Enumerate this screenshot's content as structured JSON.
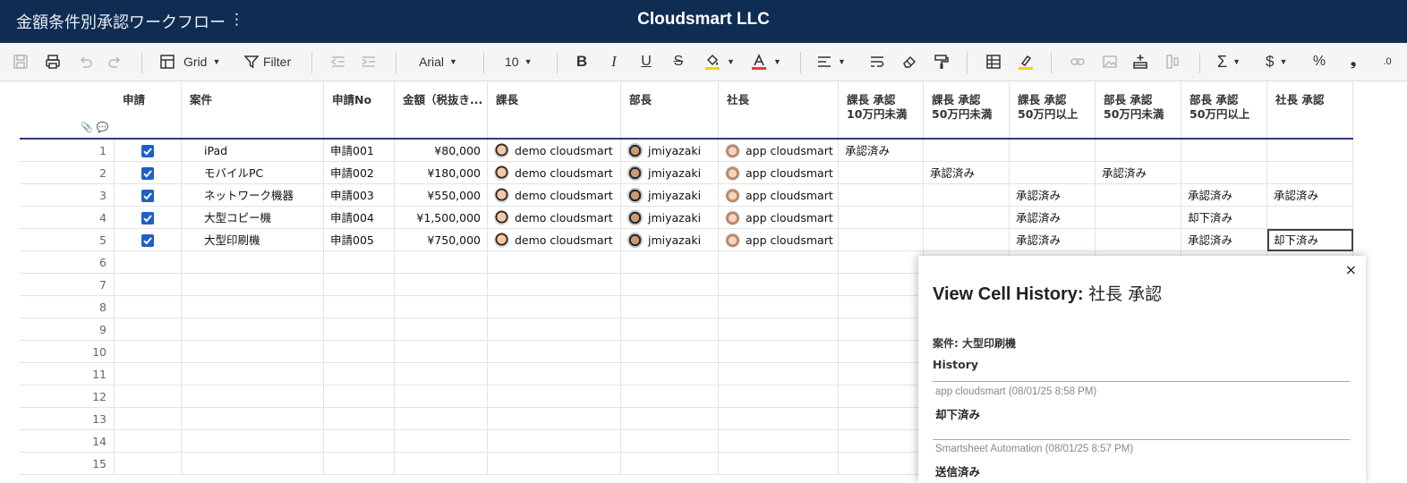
{
  "header": {
    "sheet_title": "金額条件別承認ワークフロー",
    "menu_icon": "⋮",
    "company": "Cloudsmart LLC"
  },
  "toolbar": {
    "view_label": "Grid",
    "filter_label": "Filter",
    "font_family": "Arial",
    "font_size": "10",
    "icons": [
      "save-icon",
      "print-icon",
      "undo-icon",
      "redo-icon",
      "grid-view-icon",
      "filter-icon",
      "outdent-icon",
      "indent-icon",
      "bold-icon",
      "italic-icon",
      "underline-icon",
      "strikethrough-icon",
      "fill-color-icon",
      "text-color-icon",
      "align-icon",
      "wrap-text-icon",
      "clear-format-icon",
      "format-painter-icon",
      "table-icon",
      "highlight-icon",
      "link-icon",
      "image-icon",
      "insert-row-icon",
      "freeze-column-icon",
      "sum-icon",
      "currency-icon",
      "percent-icon",
      "thousands-icon",
      "decimal-icon"
    ],
    "text_color_accent": "#e53935",
    "fill_color_accent": "#f5d400"
  },
  "columns": [
    {
      "key": "apply",
      "label": "申請"
    },
    {
      "key": "case",
      "label": "案件"
    },
    {
      "key": "no",
      "label": "申請No"
    },
    {
      "key": "amount",
      "label": "金額（税抜き..."
    },
    {
      "key": "kacho",
      "label": "課長"
    },
    {
      "key": "bucho",
      "label": "部長"
    },
    {
      "key": "shacho",
      "label": "社長"
    },
    {
      "key": "kacho_a1",
      "label": "課長 承認\n10万円未満"
    },
    {
      "key": "kacho_a2",
      "label": "課長 承認\n50万円未満"
    },
    {
      "key": "kacho_a3",
      "label": "課長 承認\n50万円以上"
    },
    {
      "key": "bucho_a1",
      "label": "部長 承認\n50万円未満"
    },
    {
      "key": "bucho_a2",
      "label": "部長 承認\n50万円以上"
    },
    {
      "key": "shacho_a",
      "label": "社長 承認"
    }
  ],
  "rows": [
    {
      "num": "1",
      "apply": true,
      "case": "iPad",
      "no": "申請001",
      "amount": "¥80,000",
      "kacho": "demo cloudsmart",
      "bucho": "jmiyazaki",
      "shacho": "app cloudsmart",
      "kacho_a1": "承認済み",
      "kacho_a2": "",
      "kacho_a3": "",
      "bucho_a1": "",
      "bucho_a2": "",
      "shacho_a": ""
    },
    {
      "num": "2",
      "apply": true,
      "case": "モバイルPC",
      "no": "申請002",
      "amount": "¥180,000",
      "kacho": "demo cloudsmart",
      "bucho": "jmiyazaki",
      "shacho": "app cloudsmart",
      "kacho_a1": "",
      "kacho_a2": "承認済み",
      "kacho_a3": "",
      "bucho_a1": "承認済み",
      "bucho_a2": "",
      "shacho_a": ""
    },
    {
      "num": "3",
      "apply": true,
      "case": "ネットワーク機器",
      "no": "申請003",
      "amount": "¥550,000",
      "kacho": "demo cloudsmart",
      "bucho": "jmiyazaki",
      "shacho": "app cloudsmart",
      "kacho_a1": "",
      "kacho_a2": "",
      "kacho_a3": "承認済み",
      "bucho_a1": "",
      "bucho_a2": "承認済み",
      "shacho_a": "承認済み"
    },
    {
      "num": "4",
      "apply": true,
      "case": "大型コピー機",
      "no": "申請004",
      "amount": "¥1,500,000",
      "kacho": "demo cloudsmart",
      "bucho": "jmiyazaki",
      "shacho": "app cloudsmart",
      "kacho_a1": "",
      "kacho_a2": "",
      "kacho_a3": "承認済み",
      "bucho_a1": "",
      "bucho_a2": "却下済み",
      "shacho_a": ""
    },
    {
      "num": "5",
      "apply": true,
      "case": "大型印刷機",
      "no": "申請005",
      "amount": "¥750,000",
      "kacho": "demo cloudsmart",
      "bucho": "jmiyazaki",
      "shacho": "app cloudsmart",
      "kacho_a1": "",
      "kacho_a2": "",
      "kacho_a3": "承認済み",
      "bucho_a1": "",
      "bucho_a2": "承認済み",
      "shacho_a": "却下済み"
    }
  ],
  "empty_rows": [
    "6",
    "7",
    "8",
    "9",
    "10",
    "11",
    "12",
    "13",
    "14",
    "15"
  ],
  "panel": {
    "title_bold": "View Cell History:",
    "title_col": "社長 承認",
    "case_label": "案件: 大型印刷機",
    "history_label": "History",
    "entries": [
      {
        "author": "app cloudsmart (08/01/25 8:58 PM)",
        "value": "却下済み"
      },
      {
        "author": "Smartsheet Automation (08/01/25 8:57 PM)",
        "value": "送信済み"
      }
    ],
    "close_icon": "×"
  }
}
